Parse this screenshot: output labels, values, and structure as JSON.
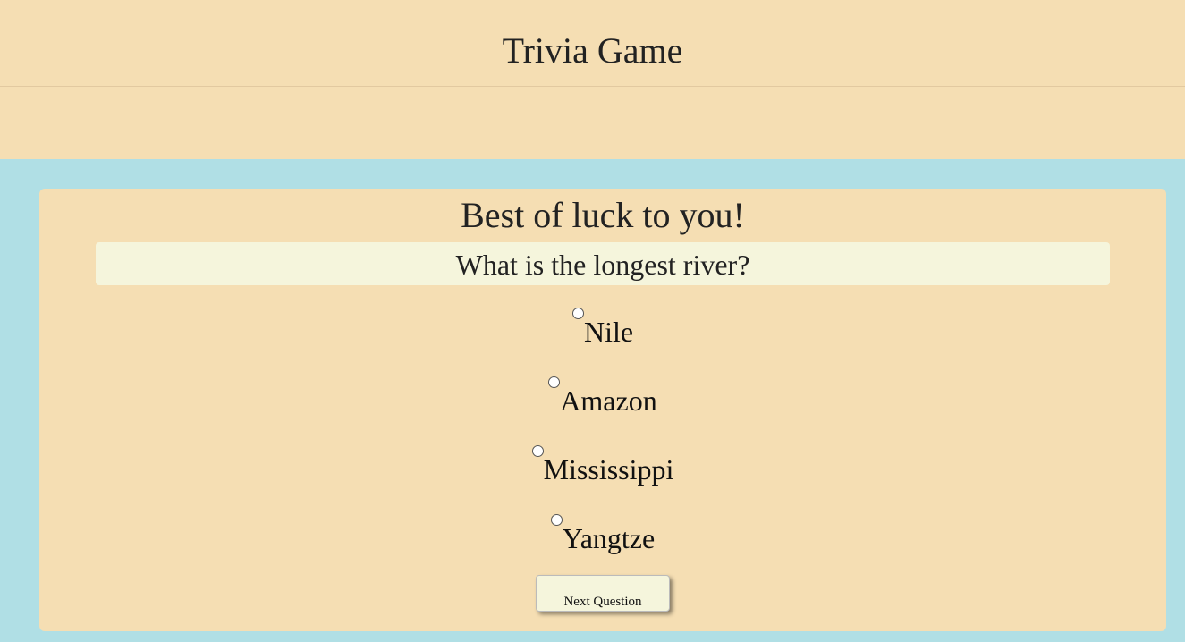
{
  "header": {
    "title": "Trivia Game"
  },
  "game": {
    "greeting": "Best of luck to you!",
    "question": "What is the longest river?",
    "answers": [
      {
        "label": "Nile",
        "selected": false
      },
      {
        "label": "Amazon",
        "selected": false
      },
      {
        "label": "Mississippi",
        "selected": false
      },
      {
        "label": "Yangtze",
        "selected": false
      }
    ],
    "next_label": "Next Question"
  },
  "colors": {
    "header_bg": "#f5deb3",
    "page_bg": "#b0dfe5",
    "question_bg": "#f5f5dc"
  }
}
